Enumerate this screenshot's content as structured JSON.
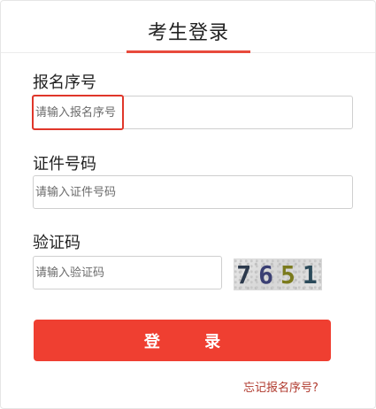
{
  "header": {
    "title": "考生登录"
  },
  "form": {
    "reg_no": {
      "label": "报名序号",
      "placeholder": "请输入报名序号"
    },
    "id_no": {
      "label": "证件号码",
      "placeholder": "请输入证件号码"
    },
    "captcha": {
      "label": "验证码",
      "placeholder": "请输入验证码",
      "image_text": [
        "7",
        "6",
        "5",
        "1"
      ]
    },
    "login_label": "登 录",
    "forgot_link": "忘记报名序号?"
  },
  "colors": {
    "accent": "#ef3f31",
    "highlight": "#e0362a",
    "link": "#b03a2e"
  }
}
